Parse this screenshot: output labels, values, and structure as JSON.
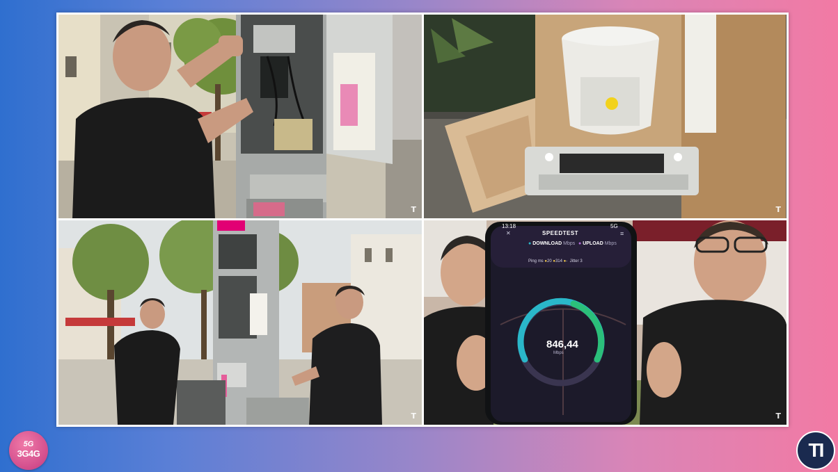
{
  "tiles": [
    {
      "label": "Engineer working inside an open street cabinet",
      "icon": "telekom-watermark"
    },
    {
      "label": "White small-cell antenna on mounting bracket",
      "icon": "telekom-watermark"
    },
    {
      "label": "Two men talking next to a phone booth with antenna",
      "icon": "telekom-watermark"
    },
    {
      "label": "Two men holding a phone showing a speed test",
      "icon": "telekom-watermark"
    }
  ],
  "watermark": "T",
  "speedtest": {
    "time": "13:18",
    "signal": "5G",
    "app_title": "SPEEDTEST",
    "download_label": "DOWNLOAD",
    "download_unit": "Mbps",
    "upload_label": "UPLOAD",
    "upload_unit": "Mbps",
    "ping_label": "Ping",
    "ping_unit": "ms",
    "ping_values": [
      "20",
      "314",
      "-"
    ],
    "jitter_label": "Jitter",
    "jitter_value": "3",
    "speed_value": "846,44",
    "speed_unit": "Mbps"
  },
  "logo_left": {
    "line1": "5G",
    "line2": "3G4G"
  },
  "logo_right": {
    "text": "TI"
  },
  "colors": {
    "gradient_left": "#2f6fcf",
    "gradient_right": "#f27aa4",
    "telekom_magenta": "#e20074",
    "gauge_green": "#2bbf7a",
    "gauge_teal": "#2ab7c9",
    "ti_navy": "#1a2a4f"
  }
}
